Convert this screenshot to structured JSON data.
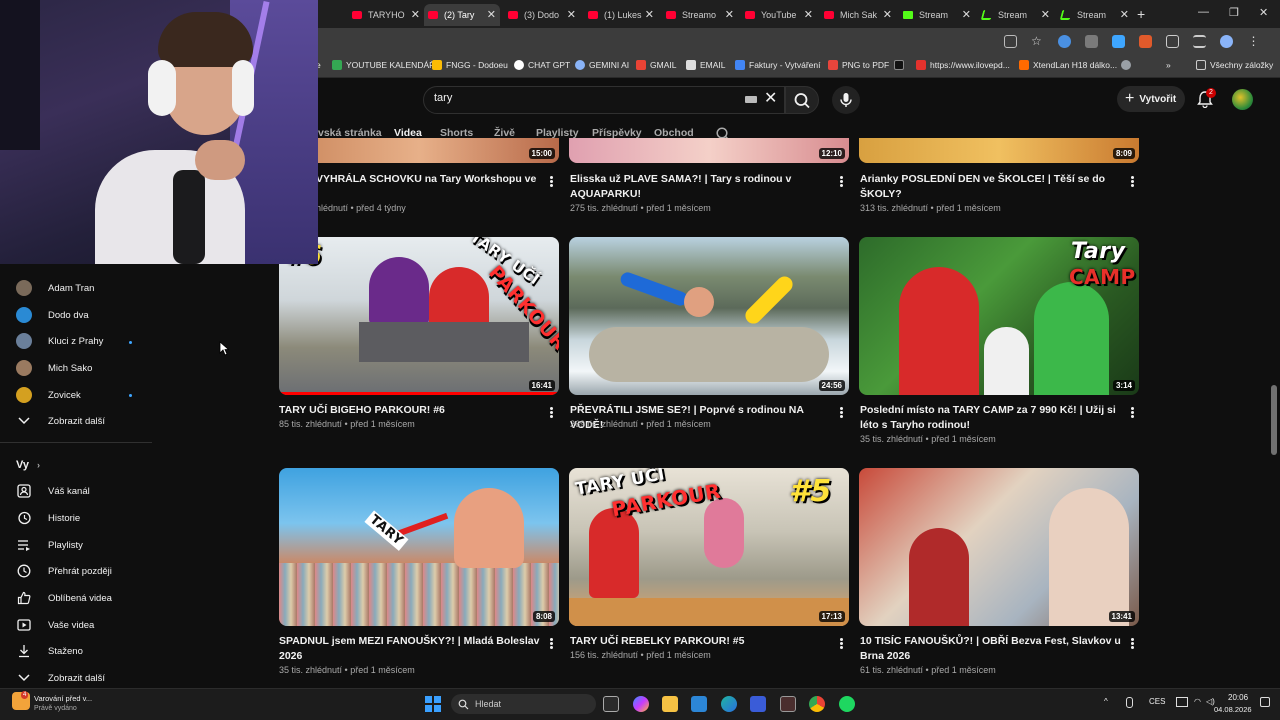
{
  "browser": {
    "tabs": [
      {
        "label": "TARYHO",
        "icon": "youtube-icon"
      },
      {
        "label": "(2) Tary",
        "icon": "youtube-icon",
        "active": true
      },
      {
        "label": "(3) Dodo",
        "icon": "youtube-icon"
      },
      {
        "label": "(1) Lukes",
        "icon": "youtube-icon"
      },
      {
        "label": "Streamo",
        "icon": "youtube-icon"
      },
      {
        "label": "YouTube",
        "icon": "youtube-icon"
      },
      {
        "label": "Mich Sak",
        "icon": "youtube-icon"
      },
      {
        "label": "Stream",
        "icon": "kick-icon"
      },
      {
        "label": "Stream",
        "icon": "streamlabs-icon"
      },
      {
        "label": "Stream",
        "icon": "streamlabs-icon"
      }
    ],
    "bookmarks": [
      {
        "label": "e",
        "color": "#3c3c3c"
      },
      {
        "label": "YOUTUBE KALENDÁŘ",
        "color": "#34a853"
      },
      {
        "label": "FNGG - Dodoeu",
        "color": "#fbbc05"
      },
      {
        "label": "CHAT GPT",
        "color": "#ffffff"
      },
      {
        "label": "GEMINI AI",
        "color": "#8ab4f8"
      },
      {
        "label": "GMAIL",
        "color": "#ea4335"
      },
      {
        "label": "EMAIL",
        "color": "#dddddd"
      },
      {
        "label": "Faktury - Vytváření",
        "color": "#4285f4"
      },
      {
        "label": "PNG to PDF",
        "color": "#e8453c"
      },
      {
        "label": "",
        "color": "#111111"
      },
      {
        "label": "https://www.ilovepd...",
        "color": "#e5322d"
      },
      {
        "label": "XtendLan H18 dálko...",
        "color": "#ff6a00"
      },
      {
        "label": "",
        "color": "#9aa0a6"
      }
    ],
    "bookmarks_more": "»",
    "all_bookmarks": "Všechny záložky"
  },
  "header": {
    "search_query": "tary",
    "create_label": "Vytvořit",
    "notifications_count": "2"
  },
  "channel_tabs": [
    "vská stránka",
    "Videa",
    "Shorts",
    "Živě",
    "Playlisty",
    "Příspěvky",
    "Obchod"
  ],
  "videos_top": [
    {
      "title": "VYHRÁLA SCHOVKU na Tary Workshopu ve",
      "meta": "hlédnutí • před 4 týdny",
      "duration": "15:00"
    },
    {
      "title": "Elisska už PLAVE SAMA?! | Tary s rodinou v AQUAPARKU!",
      "meta": "275 tis. zhlédnutí • před 1 měsícem",
      "duration": "12:10"
    },
    {
      "title": "Arianky POSLEDNÍ DEN ve ŠKOLCE! | Těší se do ŠKOLY?",
      "meta": "313 tis. zhlédnutí • před 1 měsícem",
      "duration": "8:09"
    }
  ],
  "videos": [
    {
      "title": "TARY UČÍ BIGEHO PARKOUR! #6",
      "meta": "85 tis. zhlédnutí • před 1 měsícem",
      "duration": "16:41",
      "overlay": [
        "#6",
        "TARY UČÍ",
        "PARKOUR"
      ]
    },
    {
      "title": "PŘEVRÁTILI JSME SE?! | Poprvé s rodinou NA VODĚ!",
      "meta": "269 tis. zhlédnutí • před 1 měsícem",
      "duration": "24:56",
      "overlay": []
    },
    {
      "title": "Poslední místo na TARY CAMP za 7 990 Kč! | Užij si léto s Taryho rodinou!",
      "meta": "35 tis. zhlédnutí • před 1 měsícem",
      "duration": "3:14",
      "overlay": [
        "Tary",
        "CAMP"
      ]
    },
    {
      "title": "SPADNUL jsem MEZI FANOUŠKY?! | Mladá Boleslav 2026",
      "meta": "35 tis. zhlédnutí • před 1 měsícem",
      "duration": "8:08",
      "overlay": [
        "TARY"
      ]
    },
    {
      "title": "TARY UČÍ REBELKY PARKOUR! #5",
      "meta": "156 tis. zhlédnutí • před 1 měsícem",
      "duration": "17:13",
      "overlay": [
        "TARY UČÍ",
        "PARKOUR",
        "#5"
      ]
    },
    {
      "title": "10 TISÍC FANOUŠKŮ?! | OBŘÍ Bezva Fest, Slavkov u Brna 2026",
      "meta": "61 tis. zhlédnutí • před 1 měsícem",
      "duration": "13:41",
      "overlay": []
    }
  ],
  "sidebar": {
    "subscriptions": [
      {
        "label": "Adam Tran",
        "color": "#7a6a5a",
        "live": false
      },
      {
        "label": "Dodo dva",
        "color": "#2a8ad4",
        "live": false
      },
      {
        "label": "Kluci z Prahy",
        "color": "#6a7f9a",
        "live": true
      },
      {
        "label": "Mich Sako",
        "color": "#9a7a60",
        "live": false
      },
      {
        "label": "Zovicek",
        "color": "#d4a020",
        "live": true
      }
    ],
    "show_more": "Zobrazit další",
    "you_heading": "Vy",
    "you_items": [
      {
        "label": "Váš kanál",
        "icon": "your-channel-icon"
      },
      {
        "label": "Historie",
        "icon": "history-icon"
      },
      {
        "label": "Playlisty",
        "icon": "playlists-icon"
      },
      {
        "label": "Přehrát později",
        "icon": "watch-later-icon"
      },
      {
        "label": "Oblíbená videa",
        "icon": "liked-icon"
      },
      {
        "label": "Vaše videa",
        "icon": "your-videos-icon"
      },
      {
        "label": "Staženo",
        "icon": "downloads-icon"
      },
      {
        "label": "Zobrazit další",
        "icon": "chevron-down-icon"
      }
    ]
  },
  "taskbar": {
    "notification_title": "Varování před v...",
    "notification_sub": "Právě vydáno",
    "notification_badge": "4",
    "search_placeholder": "Hledat",
    "lang": "CES",
    "time": "20:06",
    "date": "04.08.2026"
  }
}
